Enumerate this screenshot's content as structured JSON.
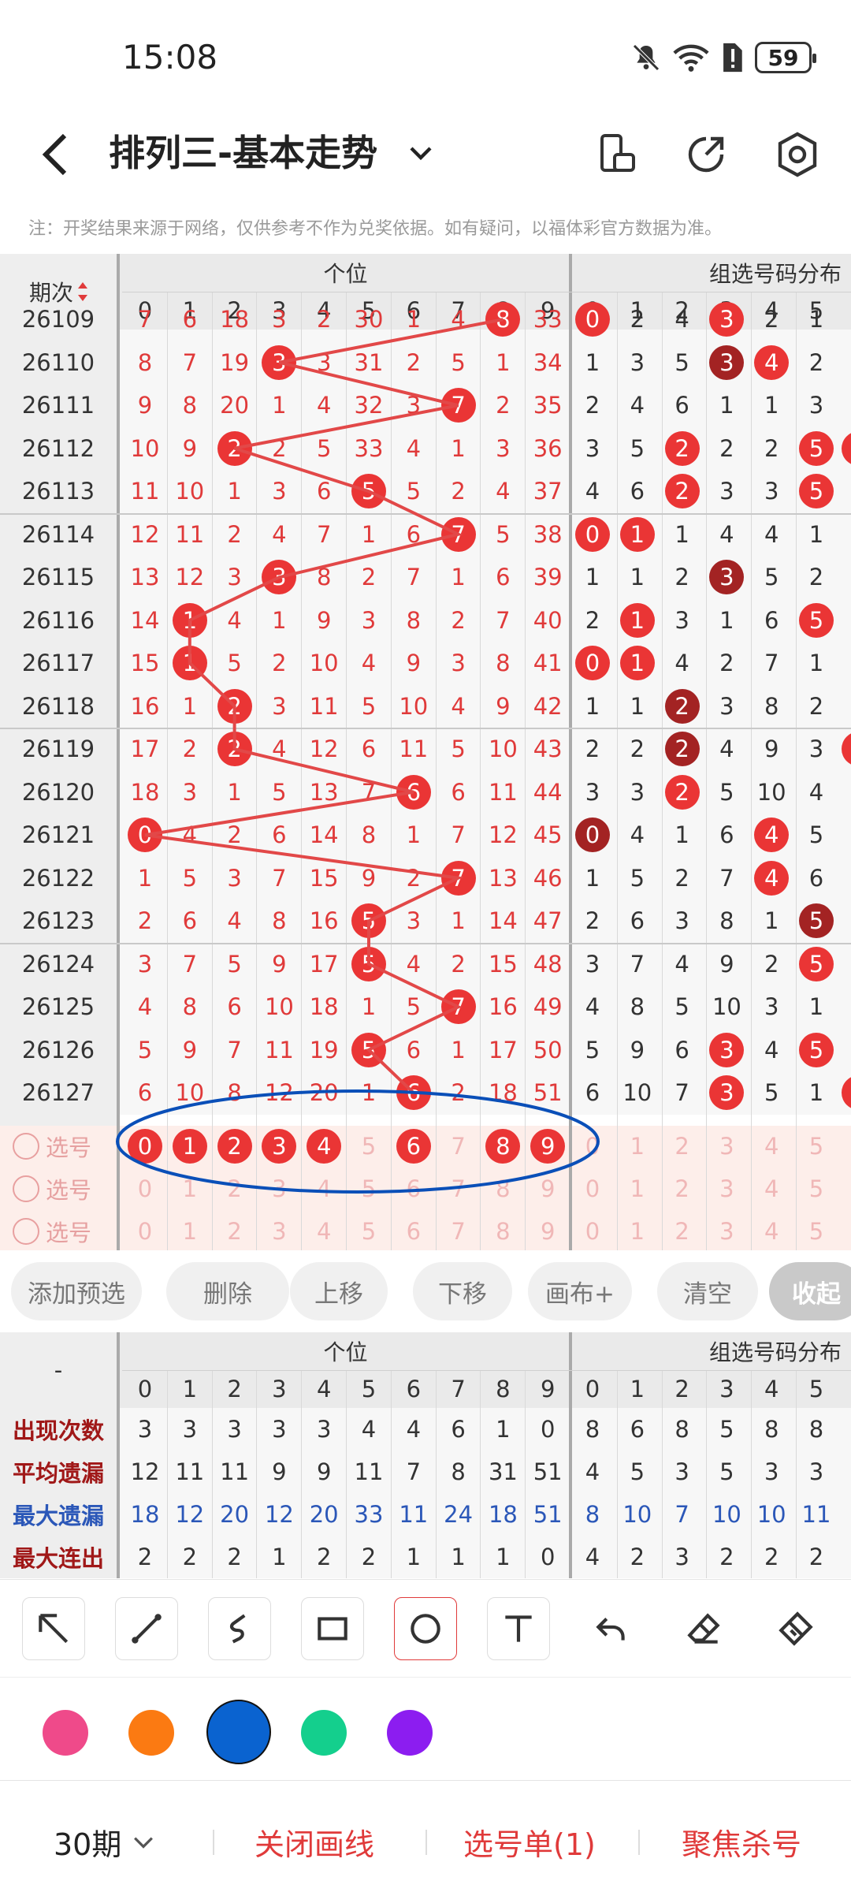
{
  "status": {
    "time": "15:08",
    "battery": "59"
  },
  "header": {
    "title": "排列三-基本走势"
  },
  "notice": "注：开奖结果来源于网络，仅供参考不作为兑奖依据。如有疑问，以福体彩官方数据为准。",
  "table": {
    "period_header": "期次",
    "group1": "个位",
    "group2": "组选号码分布",
    "digits": [
      "0",
      "1",
      "2",
      "3",
      "4",
      "5",
      "6",
      "7",
      "8",
      "9"
    ],
    "group2_digits": [
      "0",
      "1",
      "2",
      "3",
      "4",
      "5"
    ],
    "rows": [
      {
        "period": "26109",
        "cells": [
          "7",
          "6",
          "18",
          "3",
          "2",
          "30",
          "1",
          "4",
          "8",
          "33"
        ],
        "g2": [
          "0",
          "2",
          "4",
          "3",
          "2",
          "1"
        ],
        "hit": 8,
        "g2hit": [
          0,
          3
        ]
      },
      {
        "period": "26110",
        "cells": [
          "8",
          "7",
          "19",
          "3",
          "3",
          "31",
          "2",
          "5",
          "1",
          "34"
        ],
        "g2": [
          "1",
          "3",
          "5",
          "3",
          "4",
          "2"
        ],
        "hit": 3,
        "g2hit": [
          3,
          4
        ],
        "g2dark": [
          3
        ]
      },
      {
        "period": "26111",
        "cells": [
          "9",
          "8",
          "20",
          "1",
          "4",
          "32",
          "3",
          "7",
          "2",
          "35"
        ],
        "g2": [
          "2",
          "4",
          "6",
          "1",
          "1",
          "3"
        ],
        "hit": 7,
        "g2hit": []
      },
      {
        "period": "26112",
        "cells": [
          "10",
          "9",
          "2",
          "2",
          "5",
          "33",
          "4",
          "1",
          "3",
          "36"
        ],
        "g2": [
          "3",
          "5",
          "2",
          "2",
          "2",
          "5"
        ],
        "hit": 2,
        "g2hit": [
          2,
          5
        ]
      },
      {
        "period": "26113",
        "cells": [
          "11",
          "10",
          "1",
          "3",
          "6",
          "5",
          "5",
          "2",
          "4",
          "37"
        ],
        "g2": [
          "4",
          "6",
          "2",
          "3",
          "3",
          "5"
        ],
        "hit": 5,
        "g2hit": [
          2,
          5
        ]
      },
      {
        "period": "26114",
        "cells": [
          "12",
          "11",
          "2",
          "4",
          "7",
          "1",
          "6",
          "7",
          "5",
          "38"
        ],
        "g2": [
          "0",
          "1",
          "1",
          "4",
          "4",
          "1"
        ],
        "hit": 7,
        "g2hit": [
          0,
          1
        ]
      },
      {
        "period": "26115",
        "cells": [
          "13",
          "12",
          "3",
          "3",
          "8",
          "2",
          "7",
          "1",
          "6",
          "39"
        ],
        "g2": [
          "1",
          "1",
          "2",
          "3",
          "5",
          "2"
        ],
        "hit": 3,
        "g2hit": [
          3
        ],
        "g2dark": [
          3
        ]
      },
      {
        "period": "26116",
        "cells": [
          "14",
          "1",
          "4",
          "1",
          "9",
          "3",
          "8",
          "2",
          "7",
          "40"
        ],
        "g2": [
          "2",
          "1",
          "3",
          "1",
          "6",
          "5"
        ],
        "hit": 1,
        "g2hit": [
          1,
          5
        ]
      },
      {
        "period": "26117",
        "cells": [
          "15",
          "1",
          "5",
          "2",
          "10",
          "4",
          "9",
          "3",
          "8",
          "41"
        ],
        "g2": [
          "0",
          "1",
          "4",
          "2",
          "7",
          "1"
        ],
        "hit": 1,
        "g2hit": [
          0,
          1
        ]
      },
      {
        "period": "26118",
        "cells": [
          "16",
          "1",
          "2",
          "3",
          "11",
          "5",
          "10",
          "4",
          "9",
          "42"
        ],
        "g2": [
          "1",
          "1",
          "2",
          "3",
          "8",
          "2"
        ],
        "hit": 2,
        "g2hit": [
          2
        ],
        "g2dark": [
          2
        ]
      },
      {
        "period": "26119",
        "cells": [
          "17",
          "2",
          "2",
          "4",
          "12",
          "6",
          "11",
          "5",
          "10",
          "43"
        ],
        "g2": [
          "2",
          "2",
          "2",
          "4",
          "9",
          "3"
        ],
        "hit": 2,
        "g2hit": [
          2
        ],
        "g2dark": [
          2
        ]
      },
      {
        "period": "26120",
        "cells": [
          "18",
          "3",
          "1",
          "5",
          "13",
          "7",
          "6",
          "6",
          "11",
          "44"
        ],
        "g2": [
          "3",
          "3",
          "2",
          "5",
          "10",
          "4"
        ],
        "hit": 6,
        "g2hit": [
          2
        ]
      },
      {
        "period": "26121",
        "cells": [
          "0",
          "4",
          "2",
          "6",
          "14",
          "8",
          "1",
          "7",
          "12",
          "45"
        ],
        "g2": [
          "0",
          "4",
          "1",
          "6",
          "4",
          "5"
        ],
        "hit": 0,
        "g2hit": [
          0,
          4
        ],
        "g2dark": [
          0
        ]
      },
      {
        "period": "26122",
        "cells": [
          "1",
          "5",
          "3",
          "7",
          "15",
          "9",
          "2",
          "7",
          "13",
          "46"
        ],
        "g2": [
          "1",
          "5",
          "2",
          "7",
          "4",
          "6"
        ],
        "hit": 7,
        "g2hit": [
          4
        ]
      },
      {
        "period": "26123",
        "cells": [
          "2",
          "6",
          "4",
          "8",
          "16",
          "5",
          "3",
          "1",
          "14",
          "47"
        ],
        "g2": [
          "2",
          "6",
          "3",
          "8",
          "1",
          "5"
        ],
        "hit": 5,
        "g2hit": [
          5
        ],
        "g2dark": [
          5
        ]
      },
      {
        "period": "26124",
        "cells": [
          "3",
          "7",
          "5",
          "9",
          "17",
          "5",
          "4",
          "2",
          "15",
          "48"
        ],
        "g2": [
          "3",
          "7",
          "4",
          "9",
          "2",
          "5"
        ],
        "hit": 5,
        "g2hit": [
          5
        ]
      },
      {
        "period": "26125",
        "cells": [
          "4",
          "8",
          "6",
          "10",
          "18",
          "1",
          "5",
          "7",
          "16",
          "49"
        ],
        "g2": [
          "4",
          "8",
          "5",
          "10",
          "3",
          "1"
        ],
        "hit": 7,
        "g2hit": []
      },
      {
        "period": "26126",
        "cells": [
          "5",
          "9",
          "7",
          "11",
          "19",
          "5",
          "6",
          "1",
          "17",
          "50"
        ],
        "g2": [
          "5",
          "9",
          "6",
          "3",
          "4",
          "5"
        ],
        "hit": 5,
        "g2hit": [
          3,
          5
        ]
      },
      {
        "period": "26127",
        "cells": [
          "6",
          "10",
          "8",
          "12",
          "20",
          "1",
          "6",
          "2",
          "18",
          "51"
        ],
        "g2": [
          "6",
          "10",
          "7",
          "3",
          "5",
          "1"
        ],
        "hit": 6,
        "g2hit": [
          3
        ]
      }
    ],
    "select_label": "选号",
    "select_row1_hits": [
      0,
      1,
      2,
      3,
      4,
      6,
      8,
      9
    ]
  },
  "buttons": [
    "添加预选",
    "删除",
    "上移",
    "下移",
    "画布+",
    "清空",
    "收起"
  ],
  "stats": {
    "dash": "-",
    "rows": [
      {
        "label": "出现次数",
        "style": "dark",
        "cells": [
          "3",
          "3",
          "3",
          "3",
          "3",
          "4",
          "4",
          "6",
          "1",
          "0"
        ],
        "g2": [
          "8",
          "6",
          "8",
          "5",
          "8",
          "8"
        ]
      },
      {
        "label": "平均遗漏",
        "style": "dark",
        "cells": [
          "12",
          "11",
          "11",
          "9",
          "9",
          "11",
          "7",
          "8",
          "31",
          "51"
        ],
        "g2": [
          "4",
          "5",
          "3",
          "5",
          "3",
          "3"
        ]
      },
      {
        "label": "最大遗漏",
        "style": "blue",
        "cells": [
          "18",
          "12",
          "20",
          "12",
          "20",
          "33",
          "11",
          "24",
          "18",
          "51"
        ],
        "g2": [
          "8",
          "10",
          "7",
          "10",
          "10",
          "11"
        ]
      },
      {
        "label": "最大连出",
        "style": "dark",
        "cells": [
          "2",
          "2",
          "2",
          "1",
          "2",
          "2",
          "1",
          "1",
          "1",
          "0"
        ],
        "g2": [
          "4",
          "2",
          "3",
          "2",
          "2",
          "2"
        ]
      }
    ]
  },
  "colors": {
    "pink": "#ef4a8a",
    "orange": "#fb7a12",
    "blue": "#0a63d0",
    "green": "#14cf8d",
    "purple": "#8c1df0",
    "ball": "#ea3535",
    "dark_ball": "#a32323"
  },
  "bottom": {
    "periods": "30期",
    "close_line": "关闭画线",
    "select_list": "选号单(1)",
    "focus_kill": "聚焦杀号"
  }
}
